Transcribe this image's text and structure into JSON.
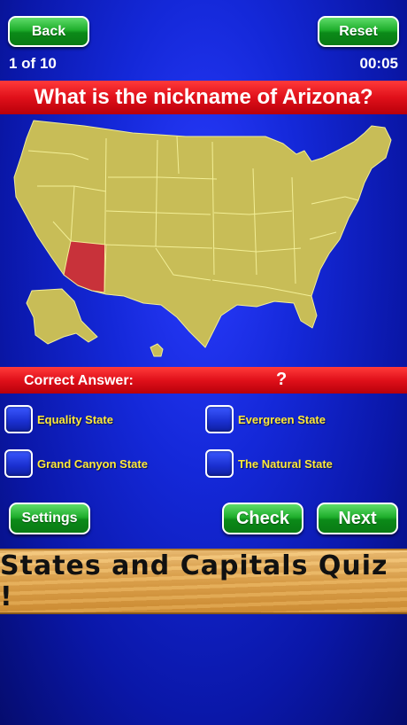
{
  "header": {
    "back_label": "Back",
    "reset_label": "Reset",
    "progress": "1 of 10",
    "timer": "00:05"
  },
  "question": {
    "text": "What is the nickname of Arizona?"
  },
  "answer_bar": {
    "label": "Correct Answer:",
    "value": "?"
  },
  "choices": [
    {
      "label": "Equality State"
    },
    {
      "label": "Evergreen State"
    },
    {
      "label": "Grand Canyon State"
    },
    {
      "label": "The Natural State"
    }
  ],
  "controls": {
    "settings_label": "Settings",
    "check_label": "Check",
    "next_label": "Next"
  },
  "banner": {
    "title": "States and Capitals Quiz !"
  },
  "colors": {
    "map_fill": "#c8bd57",
    "highlight_state": "#c8323a",
    "border_lines": "#f2ee96",
    "button_green": "#1fae2c",
    "choice_text": "#ffea3a"
  }
}
